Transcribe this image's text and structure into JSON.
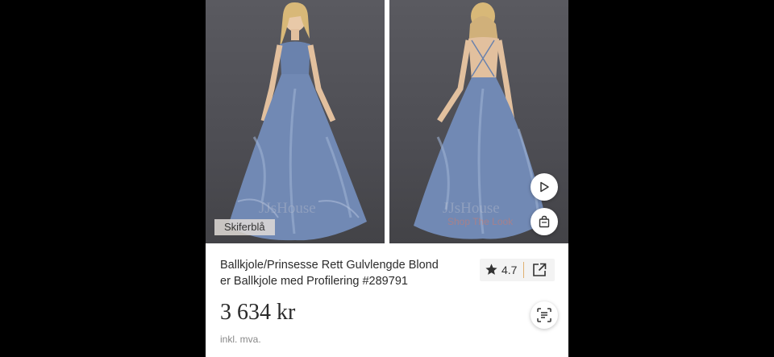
{
  "product": {
    "color_label": "Skiferblå",
    "watermark": "JJsHouse",
    "shop_the_look": "Shop The Look",
    "title": "Ballkjole/Prinsesse Rett Gulvlengde Blonder Ballkjole med Profilering #289791",
    "title_line1": "Ballkjole/Prinsesse Rett Gulvlengde Blond",
    "title_line2": "er Ballkjole med Profilering #289791",
    "rating": "4.7",
    "price": "3 634 kr",
    "vat_note": "inkl. mva."
  },
  "colors": {
    "dress": "#6f86b0",
    "background": "#55555b",
    "rating_separator": "#e0b070"
  },
  "icons": {
    "play": "play-icon",
    "bag": "shopping-bag-icon",
    "star": "star-icon",
    "share": "share-icon",
    "scan": "image-search-icon"
  }
}
